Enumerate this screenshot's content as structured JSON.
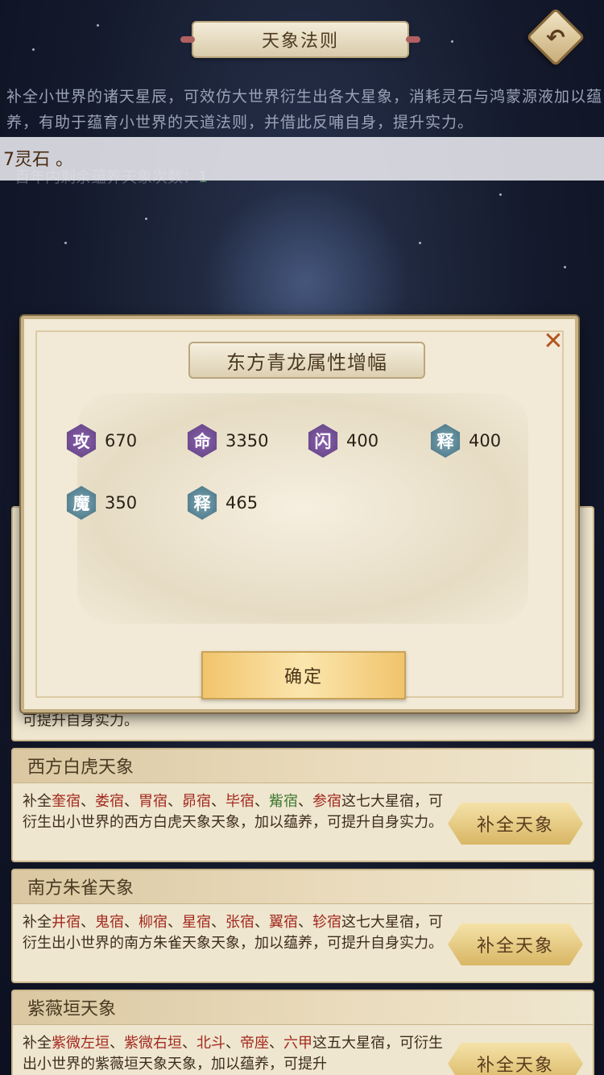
{
  "header": {
    "title": "天象法则",
    "back_icon": "back-arrow-icon"
  },
  "intro": "补全小世界的诸天星辰，可效仿大世界衍生出各大星象，消耗灵石与鸿蒙源液加以蕴养，有助于蕴育小世界的天道法则，并借此反哺自身，提升实力。",
  "tooltip": "7灵石 。",
  "remaining": {
    "label": "百年内剩余蕴养天象次数：",
    "value": "1"
  },
  "modal": {
    "title": "东方青龙属性增幅",
    "close_icon": "close-x-icon",
    "stats": [
      {
        "glyph": "攻",
        "value": "670",
        "color": "purple"
      },
      {
        "glyph": "命",
        "value": "3350",
        "color": "purple"
      },
      {
        "glyph": "闪",
        "value": "400",
        "color": "purple"
      },
      {
        "glyph": "释",
        "value": "400",
        "color": "teal"
      },
      {
        "glyph": "魔",
        "value": "350",
        "color": "teal"
      },
      {
        "glyph": "释",
        "value": "465",
        "color": "teal"
      }
    ],
    "confirm_label": "确定"
  },
  "cards": [
    {
      "title": "西方白虎天象",
      "prefix": "补全",
      "stars": [
        "奎宿",
        "娄宿",
        "胃宿",
        "昴宿",
        "毕宿",
        "觜宿",
        "参宿"
      ],
      "suffix": "这七大星宿，可衍生出小世界的西方白虎天象天象，加以蕴养，可提升自身实力。",
      "button": "补全天象"
    },
    {
      "title": "南方朱雀天象",
      "prefix": "补全",
      "stars": [
        "井宿",
        "鬼宿",
        "柳宿",
        "星宿",
        "张宿",
        "翼宿",
        "轸宿"
      ],
      "suffix": "这七大星宿，可衍生出小世界的南方朱雀天象天象，加以蕴养，可提升自身实力。",
      "button": "补全天象"
    },
    {
      "title": "紫薇垣天象",
      "prefix": "补全",
      "stars": [
        "紫微左垣",
        "紫微右垣",
        "北斗",
        "帝座",
        "六甲"
      ],
      "suffix": "这五大星宿，可衍生出小世界的紫薇垣天象天象，加以蕴养，可提升",
      "button": "补全天象"
    }
  ],
  "partial_card_text": "可提升自身实力。"
}
